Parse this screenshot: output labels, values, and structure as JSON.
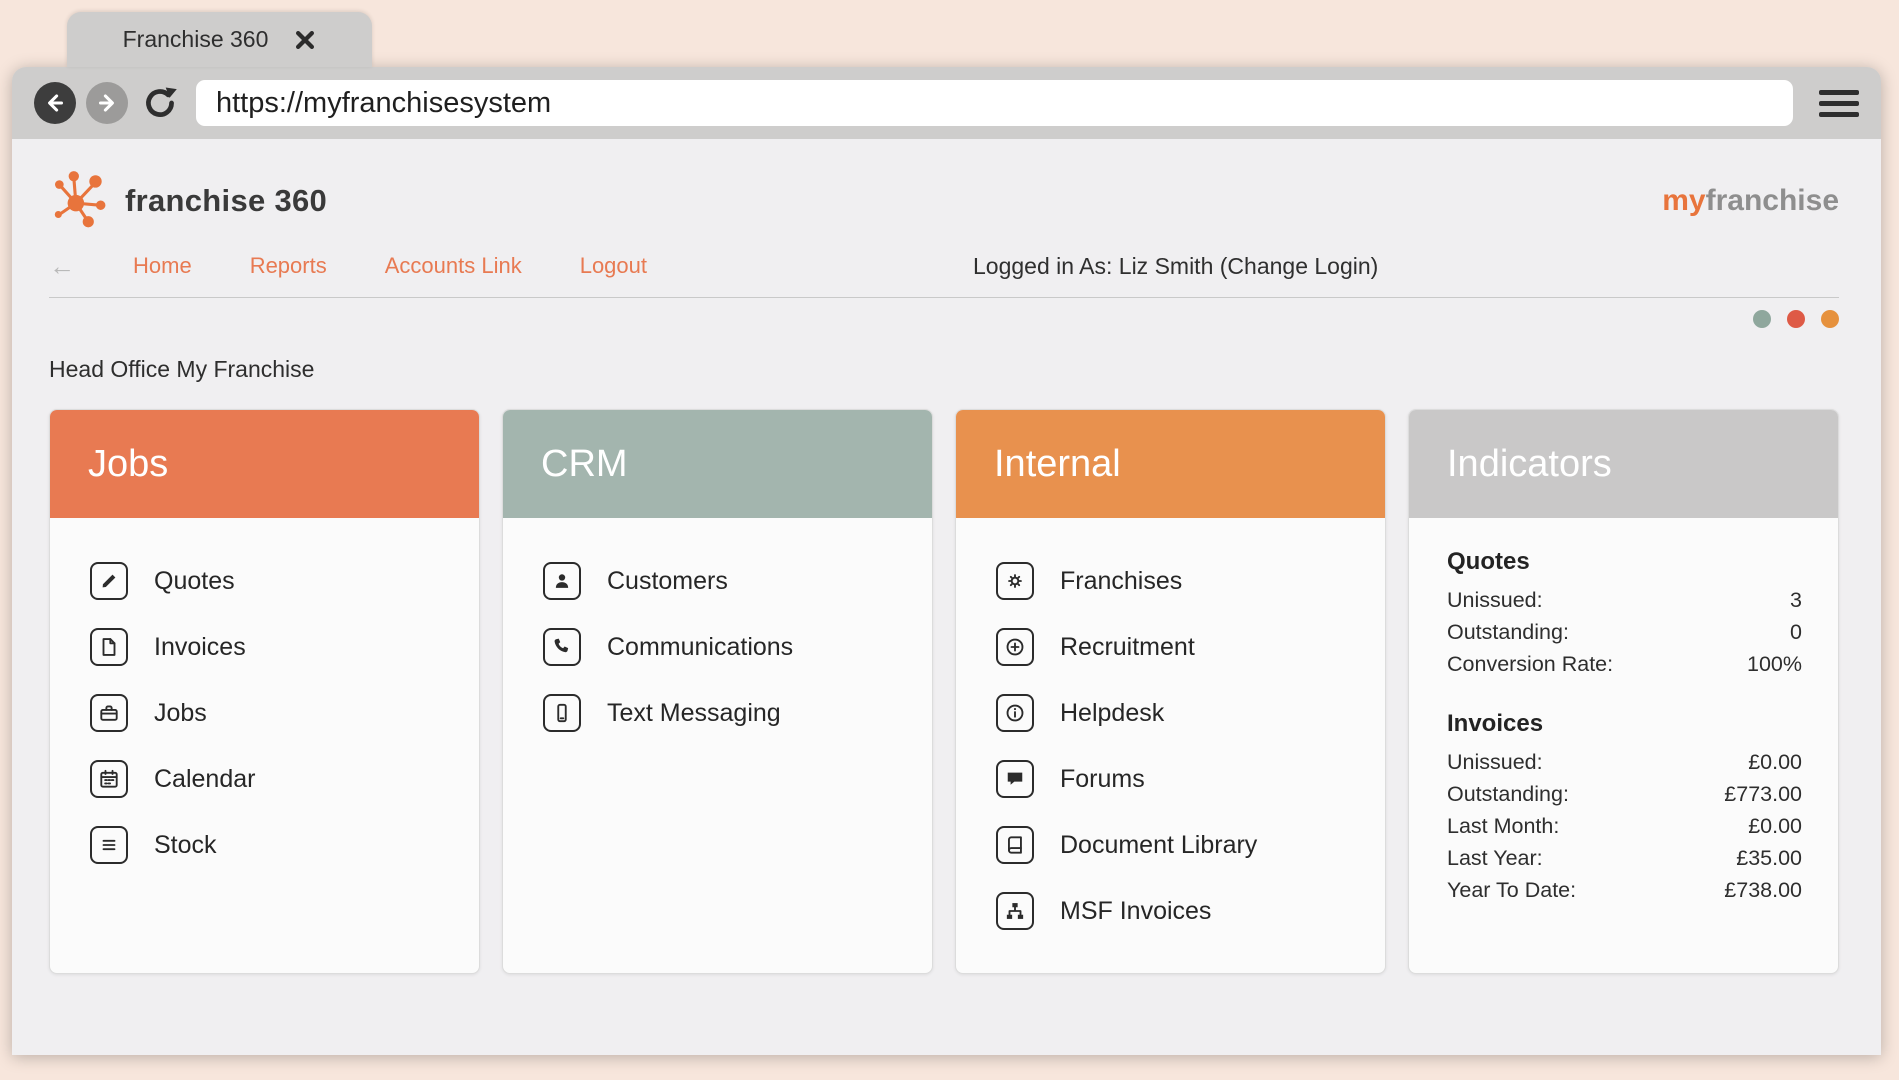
{
  "browser": {
    "tab_title": "Franchise 360",
    "url": "https://myfranchisesystem"
  },
  "header": {
    "logo_text": "franchise 360",
    "brand": {
      "my": "my",
      "franchise": "franchise"
    }
  },
  "nav": {
    "items": [
      {
        "label": "Home"
      },
      {
        "label": "Reports"
      },
      {
        "label": "Accounts Link"
      },
      {
        "label": "Logout"
      }
    ],
    "logged_in_text": "Logged in As: Liz Smith (Change Login)"
  },
  "status_dots": {
    "colors": [
      "#8fa79d",
      "#de5a46",
      "#e6913d"
    ]
  },
  "page": {
    "subtitle": "Head Office My Franchise"
  },
  "cards": [
    {
      "title": "Jobs",
      "header_color": "#e87a52",
      "items": [
        {
          "label": "Quotes",
          "icon": "pencil-square-icon"
        },
        {
          "label": "Invoices",
          "icon": "file-icon"
        },
        {
          "label": "Jobs",
          "icon": "briefcase-icon"
        },
        {
          "label": "Calendar",
          "icon": "calendar-icon"
        },
        {
          "label": "Stock",
          "icon": "list-icon"
        }
      ]
    },
    {
      "title": "CRM",
      "header_color": "#a3b5ae",
      "items": [
        {
          "label": "Customers",
          "icon": "person-icon"
        },
        {
          "label": "Communications",
          "icon": "phone-icon"
        },
        {
          "label": "Text Messaging",
          "icon": "mobile-icon"
        }
      ]
    },
    {
      "title": "Internal",
      "header_color": "#e8914e",
      "items": [
        {
          "label": "Franchises",
          "icon": "cogs-icon"
        },
        {
          "label": "Recruitment",
          "icon": "plus-circle-icon"
        },
        {
          "label": "Helpdesk",
          "icon": "info-circle-icon"
        },
        {
          "label": "Forums",
          "icon": "chat-icon"
        },
        {
          "label": "Document Library",
          "icon": "book-icon"
        },
        {
          "label": "MSF Invoices",
          "icon": "sitemap-icon"
        }
      ]
    }
  ],
  "indicators": {
    "title": "Indicators",
    "header_color": "#c9c8c8",
    "groups": [
      {
        "heading": "Quotes",
        "rows": [
          {
            "label": "Unissued:",
            "value": "3"
          },
          {
            "label": "Outstanding:",
            "value": "0"
          },
          {
            "label": "Conversion Rate:",
            "value": "100%"
          }
        ]
      },
      {
        "heading": "Invoices",
        "rows": [
          {
            "label": "Unissued:",
            "value": "£0.00"
          },
          {
            "label": "Outstanding:",
            "value": "£773.00"
          },
          {
            "label": "Last Month:",
            "value": "£0.00"
          },
          {
            "label": "Last Year:",
            "value": "£35.00"
          },
          {
            "label": "Year To Date:",
            "value": "£738.00"
          }
        ]
      }
    ]
  }
}
